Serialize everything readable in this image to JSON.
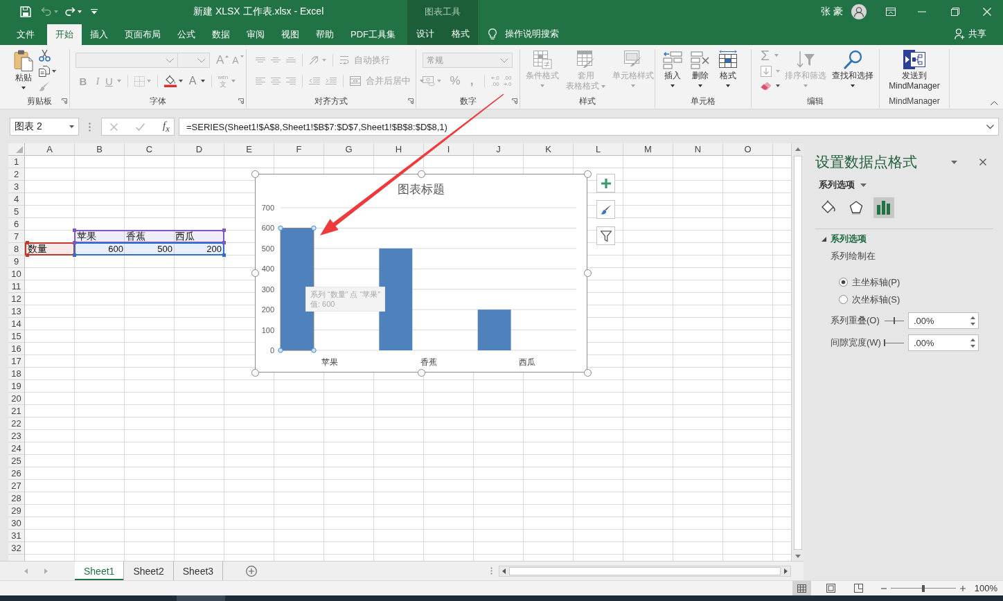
{
  "window": {
    "title": "新建 XLSX 工作表.xlsx - Excel",
    "context_group": "图表工具",
    "user": "张 豪"
  },
  "quick_access": [
    {
      "disabled": false
    },
    {
      "disabled": true,
      "menu": true
    },
    {
      "disabled": false,
      "menu": true
    }
  ],
  "tabs": [
    {
      "label": "文件",
      "selected": false,
      "contextual": false
    },
    {
      "label": "开始",
      "selected": true,
      "contextual": false
    },
    {
      "label": "插入",
      "selected": false,
      "contextual": false
    },
    {
      "label": "页面布局",
      "selected": false,
      "contextual": false
    },
    {
      "label": "公式",
      "selected": false,
      "contextual": false
    },
    {
      "label": "数据",
      "selected": false,
      "contextual": false
    },
    {
      "label": "审阅",
      "selected": false,
      "contextual": false
    },
    {
      "label": "视图",
      "selected": false,
      "contextual": false
    },
    {
      "label": "帮助",
      "selected": false,
      "contextual": false
    },
    {
      "label": "PDF工具集",
      "selected": false,
      "contextual": false
    },
    {
      "label": "设计",
      "selected": false,
      "contextual": true
    },
    {
      "label": "格式",
      "selected": false,
      "contextual": true
    }
  ],
  "tell_me": {
    "label": "操作说明搜索"
  },
  "share": {
    "label": "共享"
  },
  "ribbon": [
    {
      "label": "剪贴板",
      "launcher": true,
      "buttons": [
        {
          "lines": [
            "粘贴"
          ],
          "menu": true,
          "disabled": false
        },
        {
          "disabled": false
        },
        {
          "disabled": false,
          "menu": true
        },
        {
          "disabled": true
        }
      ]
    },
    {
      "label": "字体",
      "launcher": true,
      "fields": [
        {
          "disabled": true
        },
        {
          "disabled": true
        }
      ],
      "buttons": [
        {
          "label": "A",
          "disabled": true
        },
        {
          "label": "A",
          "disabled": true
        },
        {
          "label": "B",
          "disabled": true
        },
        {
          "label": "I",
          "disabled": true
        },
        {
          "label": "U",
          "disabled": true,
          "menu": true
        },
        {
          "disabled": true,
          "menu": true
        },
        {
          "disabled": false,
          "menu": true
        },
        {
          "label": "A",
          "disabled": false,
          "menu": true
        },
        {
          "label": "wén",
          "sub": "文",
          "disabled": true,
          "menu": true
        }
      ]
    },
    {
      "label": "对齐方式",
      "launcher": true,
      "buttons": [
        {
          "disabled": true
        },
        {
          "disabled": true
        },
        {
          "disabled": true
        },
        {
          "disabled": true,
          "menu": true
        },
        {
          "label": "自动换行",
          "disabled": true
        },
        {
          "disabled": true
        },
        {
          "disabled": true
        },
        {
          "disabled": true
        },
        {
          "disabled": true
        },
        {
          "disabled": true
        },
        {
          "label": "合并后居中",
          "disabled": true,
          "menu": true
        }
      ]
    },
    {
      "label": "数字",
      "launcher": true,
      "fields": [
        {
          "value": "常规",
          "disabled": true
        }
      ],
      "buttons": [
        {
          "disabled": true,
          "menu": true
        },
        {
          "label": "%",
          "disabled": true
        },
        {
          "label": ",",
          "disabled": true
        },
        {
          "lines": [
            ".0",
            ".00"
          ],
          "disabled": true
        },
        {
          "lines": [
            ".00",
            ".0"
          ],
          "disabled": true
        }
      ]
    },
    {
      "label": "样式",
      "launcher": false,
      "buttons": [
        {
          "lines": [
            "条件格式"
          ],
          "menu": true,
          "disabled": true
        },
        {
          "lines": [
            "套用",
            "表格格式"
          ],
          "menu": true,
          "disabled": true
        },
        {
          "lines": [
            "单元格样式"
          ],
          "menu": true,
          "disabled": true
        }
      ]
    },
    {
      "label": "单元格",
      "launcher": false,
      "buttons": [
        {
          "lines": [
            "插入"
          ],
          "menu": true,
          "disabled": false
        },
        {
          "lines": [
            "删除"
          ],
          "menu": true,
          "disabled": false
        },
        {
          "lines": [
            "格式"
          ],
          "menu": true,
          "disabled": false
        }
      ]
    },
    {
      "label": "编辑",
      "launcher": false,
      "buttons": [
        {
          "label": "Σ",
          "menu": true,
          "disabled": true
        },
        {
          "menu": true,
          "disabled": true
        },
        {
          "menu": true,
          "disabled": false
        },
        {
          "lines": [
            "排序和筛选"
          ],
          "menu": true,
          "disabled": true
        },
        {
          "lines": [
            "查找和选择"
          ],
          "menu": true,
          "disabled": false
        }
      ]
    },
    {
      "label": "MindManager",
      "launcher": false,
      "buttons": [
        {
          "lines": [
            "发送到",
            "MindManager"
          ],
          "menu": false,
          "disabled": false
        }
      ]
    }
  ],
  "formula_bar": {
    "name_box": "图表 2",
    "buttons": [
      {
        "disabled": true
      },
      {
        "disabled": true
      },
      {
        "label": "f$_{x}$",
        "disabled": false
      }
    ],
    "formula": "=SERIES(Sheet1!$A$8,Sheet1!$B$7:$D$7,Sheet1!$B$8:$D$8,1)"
  },
  "sheet": {
    "columns": [
      "A",
      "B",
      "C",
      "D",
      "E",
      "F",
      "G",
      "H",
      "I",
      "J",
      "K",
      "L",
      "M",
      "N",
      "O"
    ],
    "row_numbers": [
      "1",
      "2",
      "3",
      "4",
      "5",
      "6",
      "7",
      "8",
      "9",
      "10",
      "11",
      "12",
      "13",
      "14",
      "15",
      "16",
      "17",
      "18",
      "19",
      "20",
      "21",
      "22",
      "23",
      "24",
      "25",
      "26",
      "27",
      "28",
      "29",
      "30",
      "31",
      "32"
    ],
    "data_block": {
      "series_name": {
        "text": "数量",
        "color": "#c0392b"
      },
      "categories": {
        "color": "#7e57c2",
        "cells": [
          "苹果",
          "香蕉",
          "西瓜"
        ]
      },
      "values": {
        "color": "#2f6fcf",
        "cells": [
          "600",
          "500",
          "200"
        ]
      }
    }
  },
  "chart": {
    "selected": true,
    "chart_data": {
      "type": "bar",
      "title": "图表标题",
      "categories": [
        "苹果",
        "香蕉",
        "西瓜"
      ],
      "series": [
        {
          "color": "#4f81bd",
          "values": [
            600,
            500,
            200
          ]
        }
      ],
      "ylim": [
        0,
        700
      ],
      "yticks": [
        0,
        100,
        200,
        300,
        400,
        500,
        600,
        700
      ],
      "grid": true
    },
    "points": [
      {
        "selected": true
      },
      {
        "selected": false
      },
      {
        "selected": false
      }
    ],
    "tooltip": [
      "系列 “数量” 点 “苹果”",
      "值: 600"
    ]
  },
  "format_pane": {
    "title": "设置数据点格式",
    "options_menu": "系列选项",
    "tabs": [
      {
        "selected": false
      },
      {
        "selected": false
      },
      {
        "selected": true
      }
    ],
    "section": {
      "label": "系列选项",
      "expanded": true
    },
    "plot_on": "系列绘制在",
    "axes": [
      {
        "label": "主坐标轴(P)",
        "selected": true
      },
      {
        "label": "次坐标轴(S)",
        "selected": false
      }
    ],
    "fields": [
      {
        "label": "系列重叠(O)",
        "level": 0.5,
        "value": ".00%"
      },
      {
        "label": "间隙宽度(W)",
        "level": 0,
        "value": ".00%"
      }
    ]
  },
  "sheet_tabs": [
    {
      "label": "Sheet1",
      "selected": true
    },
    {
      "label": "Sheet2",
      "selected": false
    },
    {
      "label": "Sheet3",
      "selected": false
    }
  ],
  "status_bar": {
    "views": [
      {
        "selected": true
      },
      {
        "selected": false
      },
      {
        "selected": false
      }
    ],
    "zoom": {
      "level": 0.5,
      "label": "100%"
    }
  }
}
